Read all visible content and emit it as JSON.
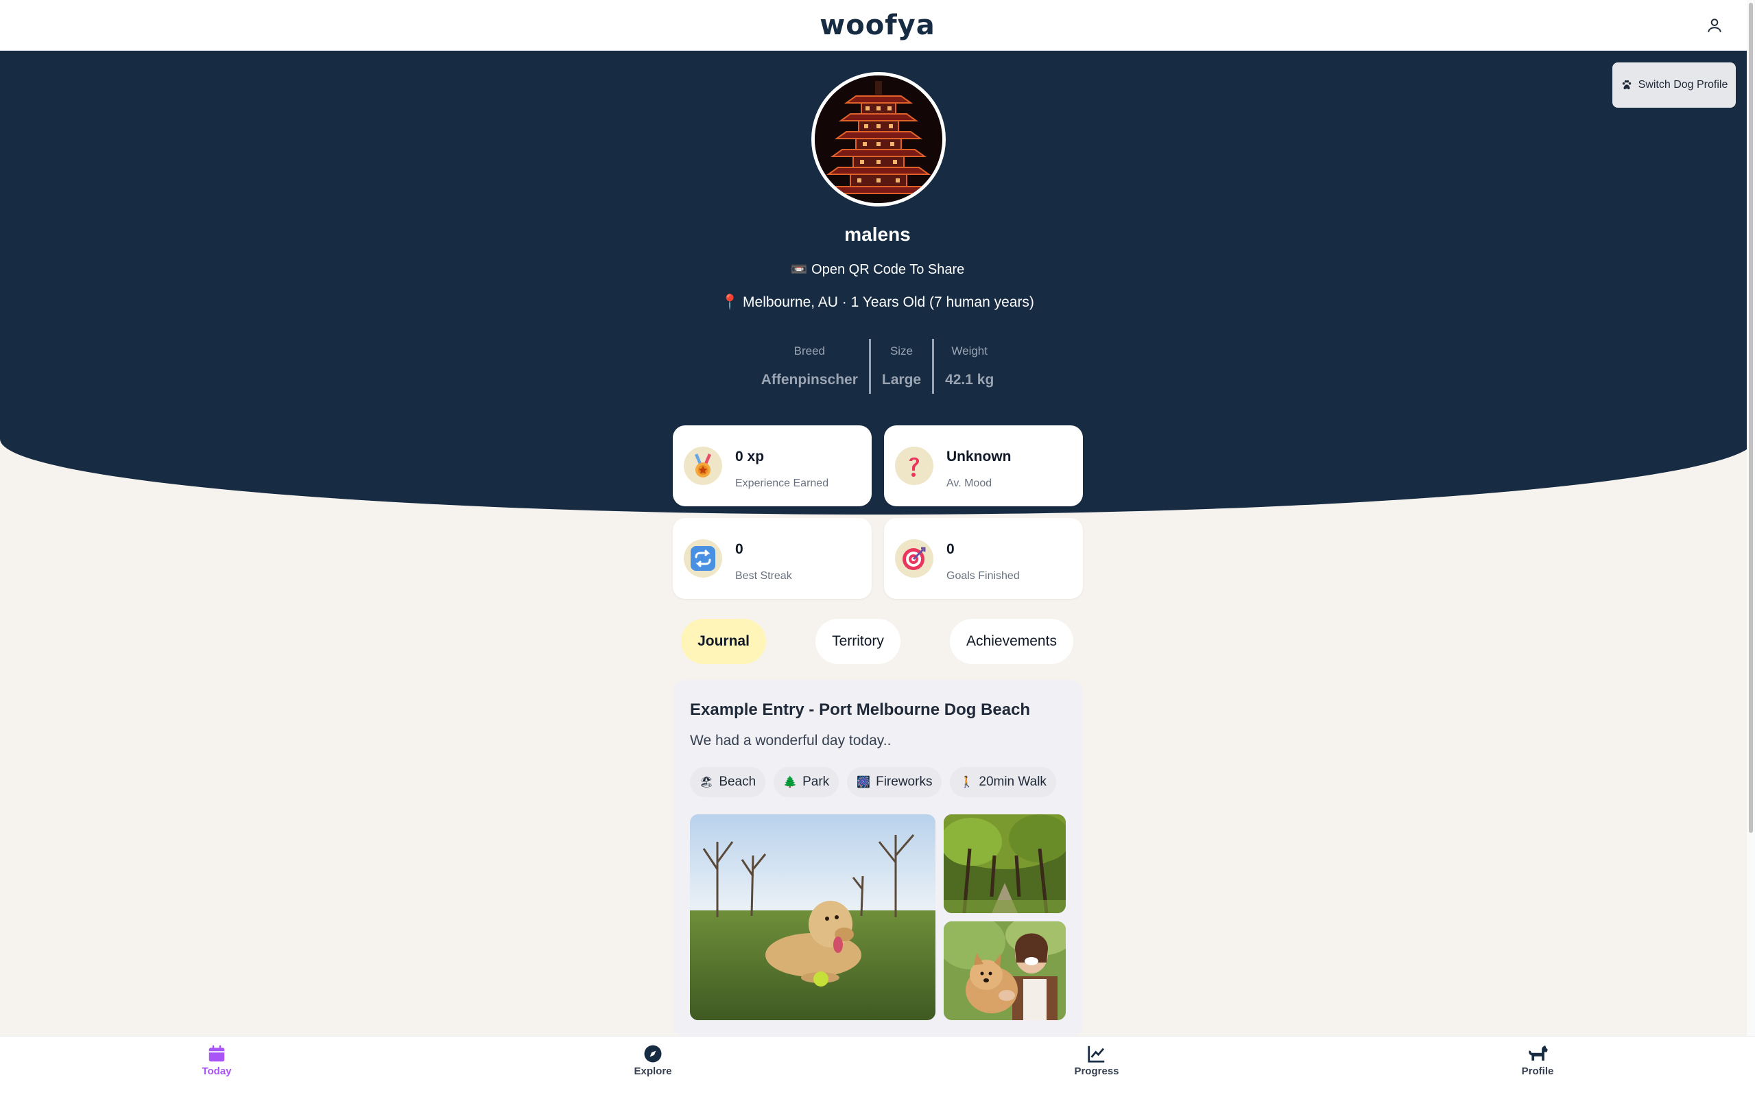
{
  "header": {
    "logo": "woofya"
  },
  "hero": {
    "switch_label": "Switch Dog Profile",
    "dog_name": "malens",
    "qr_text": "📼 Open QR Code To Share",
    "location": "📍 Melbourne, AU · 1 Years Old (7 human years)",
    "stats": [
      {
        "label": "Breed",
        "value": "Affenpinscher"
      },
      {
        "label": "Size",
        "value": "Large"
      },
      {
        "label": "Weight",
        "value": "42.1 kg"
      }
    ]
  },
  "cards": [
    {
      "value": "0 xp",
      "label": "Experience Earned",
      "icon": "medal-icon"
    },
    {
      "value": "Unknown",
      "label": "Av. Mood",
      "icon": "question-icon"
    },
    {
      "value": "0",
      "label": "Best Streak",
      "icon": "repeat-icon"
    },
    {
      "value": "0",
      "label": "Goals Finished",
      "icon": "target-icon"
    }
  ],
  "tabs": [
    {
      "label": "Journal",
      "active": true
    },
    {
      "label": "Territory",
      "active": false
    },
    {
      "label": "Achievements",
      "active": false
    }
  ],
  "entry": {
    "title": "Example Entry - Port Melbourne Dog Beach",
    "text": "We had a wonderful day today..",
    "chips": [
      {
        "icon": "🏖",
        "label": "Beach"
      },
      {
        "icon": "🌲",
        "label": "Park"
      },
      {
        "icon": "🎆",
        "label": "Fireworks"
      },
      {
        "icon": "🚶",
        "label": "20min Walk"
      }
    ]
  },
  "nav": [
    {
      "label": "Today",
      "icon": "calendar-icon",
      "active": true
    },
    {
      "label": "Explore",
      "icon": "compass-icon",
      "active": false
    },
    {
      "label": "Progress",
      "icon": "chart-icon",
      "active": false
    },
    {
      "label": "Profile",
      "icon": "dog-icon",
      "active": false
    }
  ],
  "colors": {
    "navy": "#172b43",
    "active_tab": "#fff5b8",
    "nav_active": "#a855f7"
  }
}
